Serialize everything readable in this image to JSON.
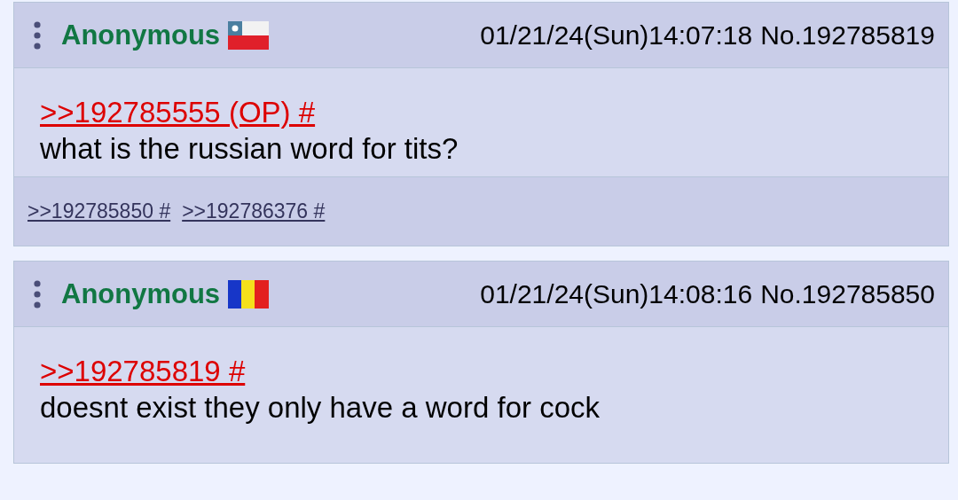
{
  "posts": [
    {
      "name": "Anonymous",
      "flag": {
        "kind": "chile"
      },
      "datetime": "01/21/24(Sun)14:07:18",
      "number": "No.192785819",
      "quotes": [
        {
          "text": ">>192785555 (OP) #"
        }
      ],
      "message": "what is the russian word for tits?",
      "replies": [
        {
          "text": ">>192785850 #"
        },
        {
          "text": ">>192786376 #"
        }
      ]
    },
    {
      "name": "Anonymous",
      "flag": {
        "kind": "romania"
      },
      "datetime": "01/21/24(Sun)14:08:16",
      "number": "No.192785850",
      "quotes": [
        {
          "text": ">>192785819 #"
        }
      ],
      "message": "doesnt exist they only have a word for cock"
    }
  ]
}
